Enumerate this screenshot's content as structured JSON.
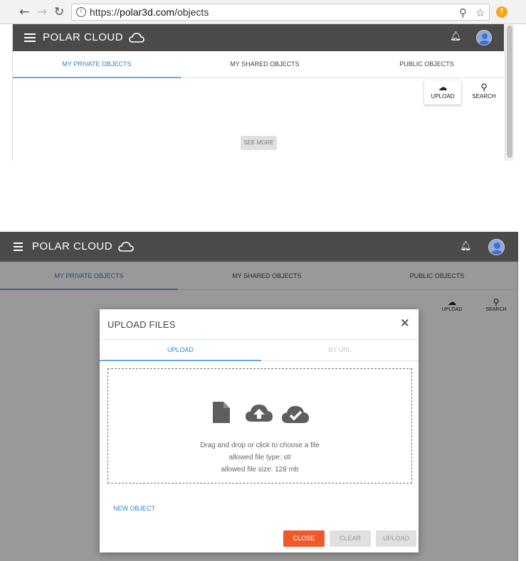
{
  "browser": {
    "url_prefix": "https://",
    "url_domain": "polar3d.com",
    "url_path": "/objects",
    "back_icon": "arrow-left-icon",
    "forward_icon": "arrow-right-icon",
    "reload_icon": "reload-icon",
    "info_icon": "info-icon",
    "zoom_icon": "magnifier-icon",
    "star_icon": "star-icon",
    "extension_icon": "extension-icon"
  },
  "app": {
    "logo_text": "POLAR CLOUD",
    "tabs": [
      {
        "label": "MY PRIVATE OBJECTS",
        "active": true
      },
      {
        "label": "MY SHARED OBJECTS",
        "active": false
      },
      {
        "label": "PUBLIC OBJECTS",
        "active": false
      }
    ],
    "upload_label": "UPLOAD",
    "search_label": "SEARCH",
    "see_more_label": "SEE MORE"
  },
  "modal": {
    "title": "UPLOAD FILES",
    "tabs": [
      {
        "label": "UPLOAD",
        "active": true
      },
      {
        "label": "BY URL",
        "active": false
      }
    ],
    "drop_text": "Drag and drop or click to choose a file",
    "allowed_type": "allowed file type: stl",
    "allowed_size": "allowed file size: 128 mb",
    "new_object_label": "NEW OBJECT",
    "close_label": "CLOSE",
    "clear_label": "CLEAR",
    "upload_label": "UPLOAD"
  },
  "colors": {
    "header_bg": "#4a4a4a",
    "accent_blue": "#2b85c7",
    "close_button": "#f05a2b"
  }
}
